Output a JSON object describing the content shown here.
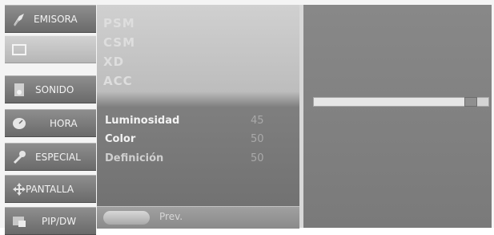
{
  "categories": [
    {
      "label": "EMISORA",
      "icon": "satellite-dish-icon"
    },
    {
      "label": "",
      "icon": "picture-screen-icon"
    },
    {
      "label": "SONIDO",
      "icon": "speaker-icon"
    },
    {
      "label": "HORA",
      "icon": "clock-icon"
    },
    {
      "label": "ESPECIAL",
      "icon": "wrench-icon"
    },
    {
      "label": "PANTALLA",
      "icon": "move-arrows-icon"
    },
    {
      "label": "PIP/DW",
      "icon": "pip-icon"
    }
  ],
  "submenu": {
    "faded_items": [
      "PSM",
      "CSM",
      "XD",
      "ACC"
    ],
    "rows": [
      {
        "name": "Luminosidad",
        "value": "45"
      },
      {
        "name": "Color",
        "value": "50"
      },
      {
        "name": "Definición",
        "value": "50"
      }
    ],
    "prev_label": "Prev."
  },
  "slider": {
    "level_fraction": 0.93
  },
  "colors": {
    "category_bg": "#7c7c7c",
    "selected_bg": "#c6c6c6",
    "panel_bg": "#808080"
  }
}
